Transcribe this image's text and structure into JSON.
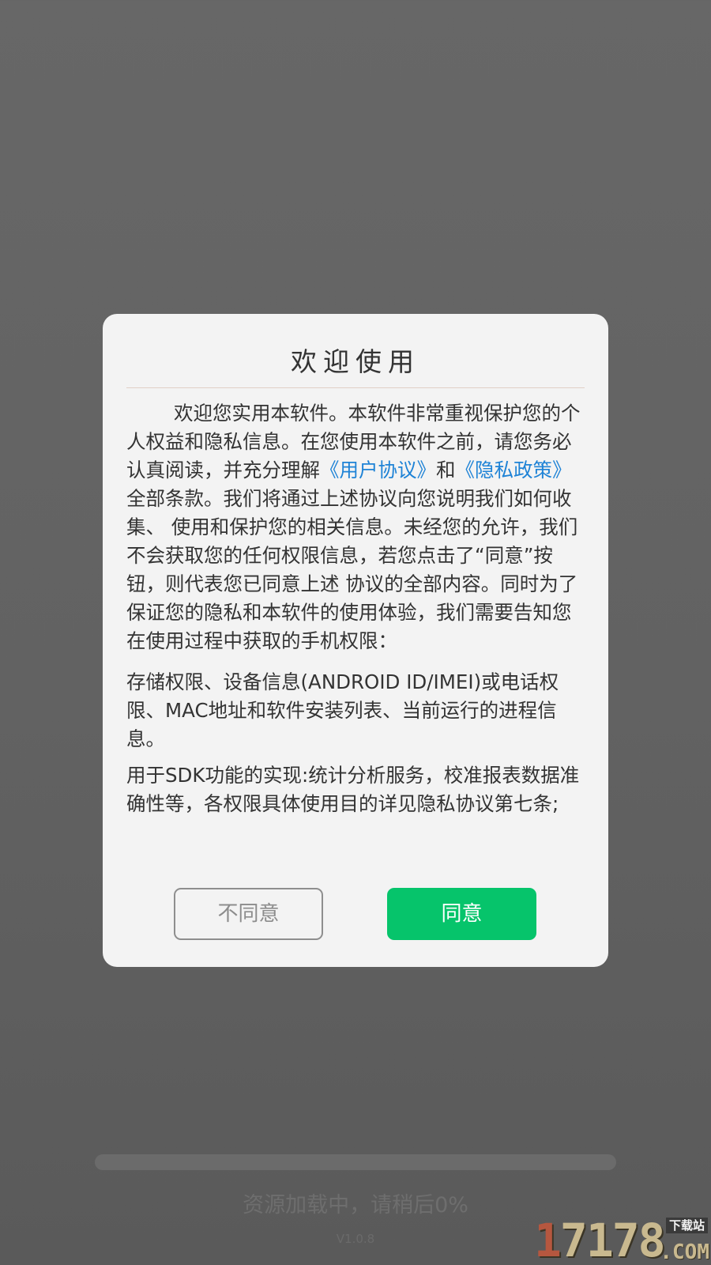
{
  "background": {
    "loading_text": "资源加载中，请稍后0%",
    "progress_percent": 0,
    "version": "V1.0.8"
  },
  "dialog": {
    "title": "欢迎使用",
    "body": {
      "main_before_user_agreement": "欢迎您实用本软件。本软件非常重视保护您的个人权益和隐私信息。在您使用本软件之前，请您务必认真阅读，并充分理解",
      "user_agreement_link": "《用户协议》",
      "and_text": "和",
      "privacy_policy_link": "《隐私政策》",
      "main_after_links": "全部条款。我们将通过上述协议向您说明我们如何收集、 使用和保护您的相关信息。未经您的允许，我们不会获取您的任何权限信息，若您点击了“同意”按钮，则代表您已同意上述 协议的全部内容。同时为了保证您的隐私和本软件的使用体验，我们需要告知您在使用过程中获取的手机权限：",
      "permissions": "存储权限、设备信息(ANDROID ID/IMEI)或电话权限、MAC地址和软件安装列表、当前运行的进程信息。",
      "sdk_usage": "用于SDK功能的实现:统计分析服务，校准报表数据准确性等，各权限具体使用目的详见隐私协议第七条;"
    },
    "disagree_label": "不同意",
    "agree_label": "同意"
  },
  "watermark": {
    "number": "17178",
    "tag": "下载站",
    "domain": ".COM"
  },
  "colors": {
    "agree_button": "#06c46b",
    "link": "#1f83d6",
    "overlay": "#636363",
    "dialog_bg": "#f3f3f3"
  }
}
